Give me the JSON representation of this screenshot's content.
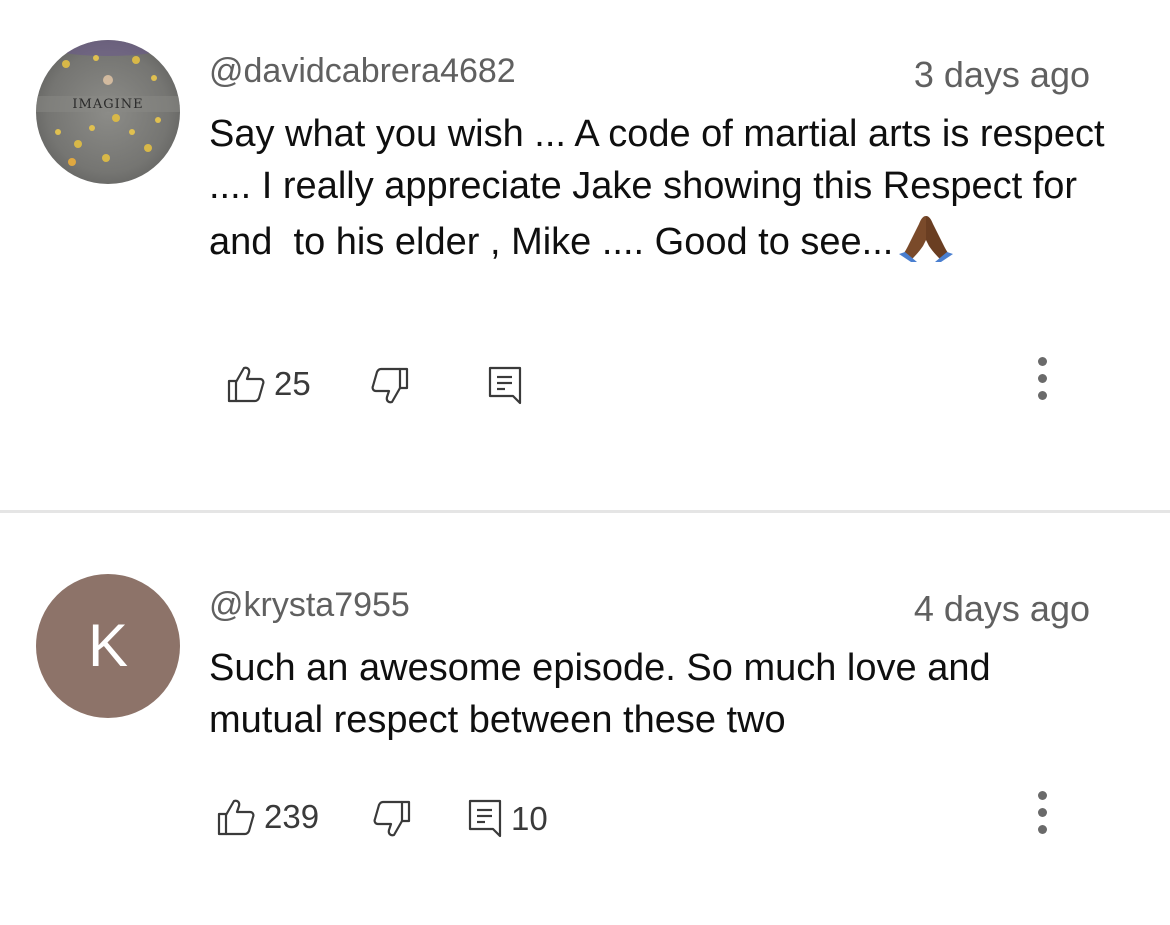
{
  "comments": [
    {
      "username": "@davidcabrera4682",
      "timestamp": "3 days ago",
      "avatar_text": "IMAGINE",
      "body": "Say what you wish ... A code of martial arts is respect .... I really appreciate Jake showing this Respect for and  to his elder , Mike .... Good to see...",
      "emoji": "folded-hands-emoji",
      "likes": "25",
      "replies": ""
    },
    {
      "username": "@krysta7955",
      "timestamp": "4 days ago",
      "avatar_letter": "K",
      "avatar_color": "#8d7369",
      "body": "Such an awesome episode. So much love and mutual respect between these two",
      "likes": "239",
      "replies": "10"
    }
  ],
  "colors": {
    "divider": "#e5e5e5",
    "secondary_text": "#606060",
    "primary_text": "#0f0f0f"
  }
}
